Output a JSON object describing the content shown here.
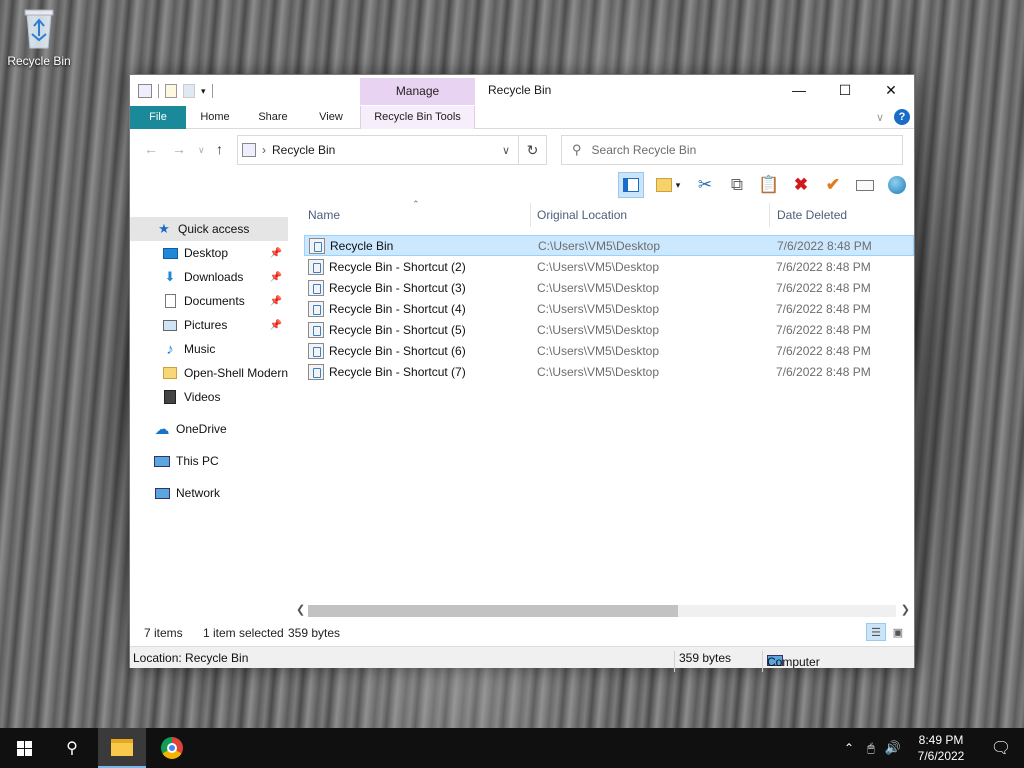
{
  "desktop": {
    "recycle_bin_label": "Recycle Bin"
  },
  "window": {
    "title": "Recycle Bin",
    "manage_label": "Manage",
    "ribbon_tabs": [
      {
        "label": "File"
      },
      {
        "label": "Home"
      },
      {
        "label": "Share"
      },
      {
        "label": "View"
      },
      {
        "label": "Recycle Bin Tools"
      }
    ],
    "address": "Recycle Bin",
    "search_placeholder": "Search Recycle Bin",
    "accent_color": "#1a8a9a",
    "manage_color": "#e9d3f3"
  },
  "sidebar": {
    "items": [
      {
        "label": "Quick access",
        "icon": "star-icon",
        "selected": true
      },
      {
        "label": "Desktop",
        "icon": "desktop-icon",
        "pinned": true
      },
      {
        "label": "Downloads",
        "icon": "download-icon",
        "pinned": true
      },
      {
        "label": "Documents",
        "icon": "document-icon",
        "pinned": true
      },
      {
        "label": "Pictures",
        "icon": "pictures-icon",
        "pinned": true
      },
      {
        "label": "Music",
        "icon": "music-icon"
      },
      {
        "label": "Open-Shell Modern",
        "icon": "folder-icon"
      },
      {
        "label": "Videos",
        "icon": "video-icon"
      },
      {
        "label": "OneDrive",
        "icon": "cloud-icon"
      },
      {
        "label": "This PC",
        "icon": "computer-icon"
      },
      {
        "label": "Network",
        "icon": "network-icon"
      }
    ]
  },
  "columns": {
    "name": "Name",
    "location": "Original Location",
    "date": "Date Deleted"
  },
  "files": [
    {
      "name": "Recycle Bin",
      "location": "C:\\Users\\VM5\\Desktop",
      "date": "7/6/2022 8:48 PM",
      "selected": true
    },
    {
      "name": "Recycle Bin - Shortcut (2)",
      "location": "C:\\Users\\VM5\\Desktop",
      "date": "7/6/2022 8:48 PM"
    },
    {
      "name": "Recycle Bin - Shortcut (3)",
      "location": "C:\\Users\\VM5\\Desktop",
      "date": "7/6/2022 8:48 PM"
    },
    {
      "name": "Recycle Bin - Shortcut (4)",
      "location": "C:\\Users\\VM5\\Desktop",
      "date": "7/6/2022 8:48 PM"
    },
    {
      "name": "Recycle Bin - Shortcut (5)",
      "location": "C:\\Users\\VM5\\Desktop",
      "date": "7/6/2022 8:48 PM"
    },
    {
      "name": "Recycle Bin - Shortcut (6)",
      "location": "C:\\Users\\VM5\\Desktop",
      "date": "7/6/2022 8:48 PM"
    },
    {
      "name": "Recycle Bin - Shortcut (7)",
      "location": "C:\\Users\\VM5\\Desktop",
      "date": "7/6/2022 8:48 PM"
    }
  ],
  "status": {
    "item_count": "7 items",
    "selection": "1 item selected",
    "size": "359 bytes",
    "location": "Location: Recycle Bin",
    "size_bottom": "359 bytes",
    "computer": "Computer"
  },
  "taskbar": {
    "time": "8:49 PM",
    "date": "7/6/2022"
  }
}
